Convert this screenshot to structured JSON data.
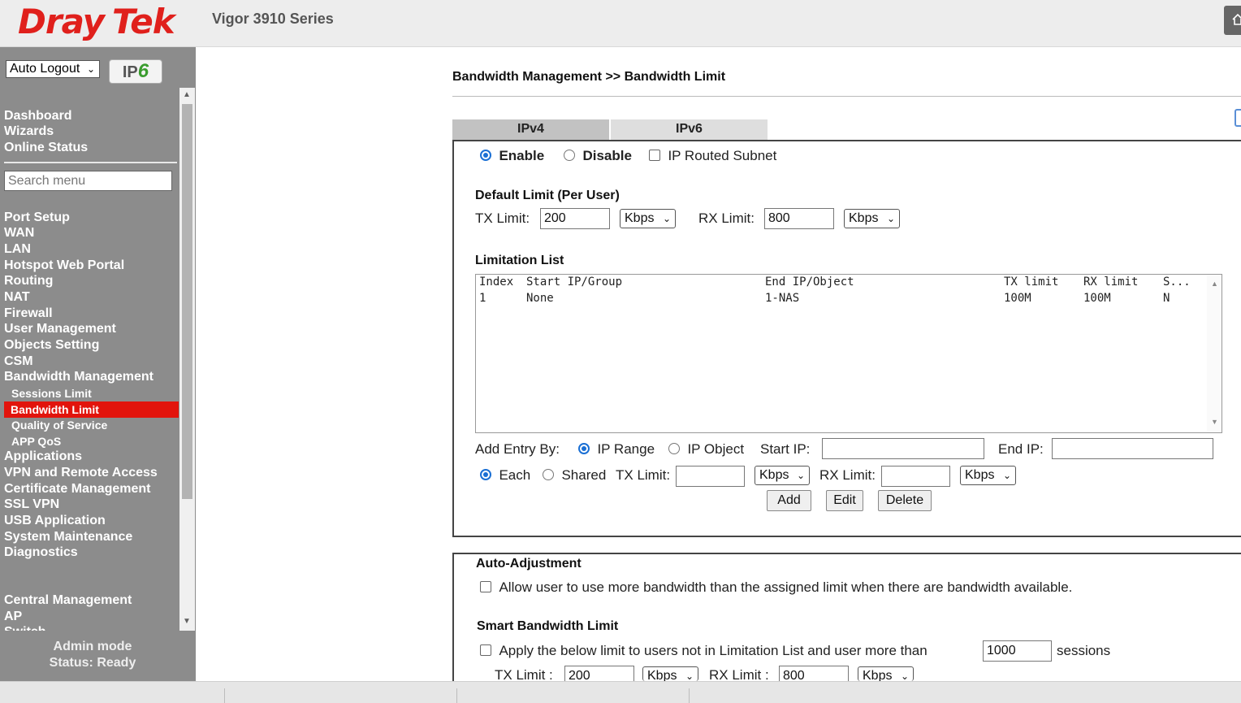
{
  "header": {
    "logo_dray": "Dray",
    "logo_tek": "Tek",
    "model": "Vigor 3910 Series",
    "home_icon": "home-icon"
  },
  "sidebar": {
    "auto_logout": "Auto Logout",
    "ipv6_badge_prefix": "IP",
    "ipv6_badge_num": "6",
    "top_items": [
      "Dashboard",
      "Wizards",
      "Online Status"
    ],
    "search_placeholder": "Search menu",
    "items": [
      "Port Setup",
      "WAN",
      "LAN",
      "Hotspot Web Portal",
      "Routing",
      "NAT",
      "Firewall",
      "User Management",
      "Objects Setting",
      "CSM",
      "Bandwidth Management"
    ],
    "sub_items": [
      "Sessions Limit",
      "Bandwidth Limit",
      "Quality of Service",
      "APP QoS"
    ],
    "active_sub_item": "Bandwidth Limit",
    "items_after": [
      "Applications",
      "VPN and Remote Access",
      "Certificate Management",
      "SSL VPN",
      "USB Application",
      "System Maintenance",
      "Diagnostics"
    ],
    "central_items": [
      "Central Management",
      "AP",
      "Switch"
    ],
    "admin_mode": "Admin mode",
    "status": "Status: Ready",
    "active_color": "#e2140c"
  },
  "main": {
    "breadcrumb": "Bandwidth Management >> Bandwidth Limit",
    "tabs": [
      {
        "label": "IPv4",
        "active": true
      },
      {
        "label": "IPv6",
        "active": false
      }
    ],
    "mode": {
      "enable": "Enable",
      "disable": "Disable",
      "ip_routed_subnet": "IP Routed Subnet",
      "selected": "Enable"
    },
    "default_limit": {
      "title": "Default Limit (Per User)",
      "tx_label": "TX Limit:",
      "tx_value": "200",
      "tx_unit": "Kbps",
      "rx_label": "RX Limit:",
      "rx_value": "800",
      "rx_unit": "Kbps"
    },
    "limitation_list": {
      "title": "Limitation List",
      "columns": [
        "Index",
        "Start IP/Group",
        "End IP/Object",
        "TX limit",
        "RX limit",
        "S..."
      ],
      "rows": [
        [
          "1",
          "None",
          "1-NAS",
          "100M",
          "100M",
          "N"
        ]
      ]
    },
    "add_entry": {
      "label": "Add Entry By:",
      "ip_range": "IP Range",
      "ip_object": "IP Object",
      "selected": "IP Range",
      "start_ip_label": "Start IP:",
      "start_ip_value": "",
      "end_ip_label": "End IP:",
      "end_ip_value": "",
      "each": "Each",
      "shared": "Shared",
      "share_selected": "Each",
      "tx_label": "TX Limit:",
      "tx_value": "",
      "tx_unit": "Kbps",
      "rx_label": "RX Limit:",
      "rx_value": "",
      "rx_unit": "Kbps",
      "buttons": {
        "add": "Add",
        "edit": "Edit",
        "delete": "Delete"
      }
    },
    "auto_adjustment": {
      "title": "Auto-Adjustment",
      "checkbox_label": "Allow user to use more bandwidth than the assigned limit when there are bandwidth available.",
      "checked": false
    },
    "smart_limit": {
      "title": "Smart Bandwidth Limit",
      "checkbox_label": "Apply the below limit to users not in Limitation List and user more than",
      "sessions_value": "1000",
      "sessions_label": "sessions",
      "tx_label": "TX Limit :",
      "tx_value": "200",
      "tx_unit": "Kbps",
      "rx_label": "RX Limit :",
      "rx_value": "800",
      "rx_unit": "Kbps"
    }
  }
}
